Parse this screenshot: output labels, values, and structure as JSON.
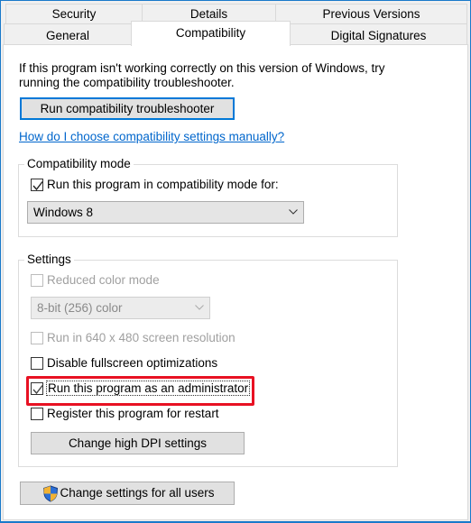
{
  "tabs_row1": [
    "Security",
    "Details",
    "Previous Versions"
  ],
  "tabs_row2": [
    "General",
    "Compatibility",
    "Digital Signatures"
  ],
  "selected_tab": "Compatibility",
  "intro": [
    "If this program isn't working correctly on this version of Windows, try",
    "running the compatibility troubleshooter."
  ],
  "troubleshooter_button": "Run compatibility troubleshooter",
  "help_link": "How do I choose compatibility settings manually?",
  "compat_mode": {
    "legend": "Compatibility mode",
    "checkbox_label": "Run this program in compatibility mode for:",
    "checked": true,
    "selected_os": "Windows 8"
  },
  "settings": {
    "legend": "Settings",
    "reduced_color": {
      "label": "Reduced color mode",
      "checked": false,
      "disabled": true
    },
    "color_select": "8-bit (256) color",
    "res640": {
      "label": "Run in 640 x 480 screen resolution",
      "checked": false,
      "disabled": true
    },
    "fullscreen": {
      "label": "Disable fullscreen optimizations",
      "checked": false
    },
    "admin": {
      "label": "Run this program as an administrator",
      "checked": true
    },
    "restart": {
      "label": "Register this program for restart",
      "checked": false
    },
    "dpi_button": "Change high DPI settings"
  },
  "all_users_button": "Change settings for all users",
  "colors": {
    "highlight": "#e81123",
    "link": "#0066cc",
    "border": "#1979ca"
  }
}
